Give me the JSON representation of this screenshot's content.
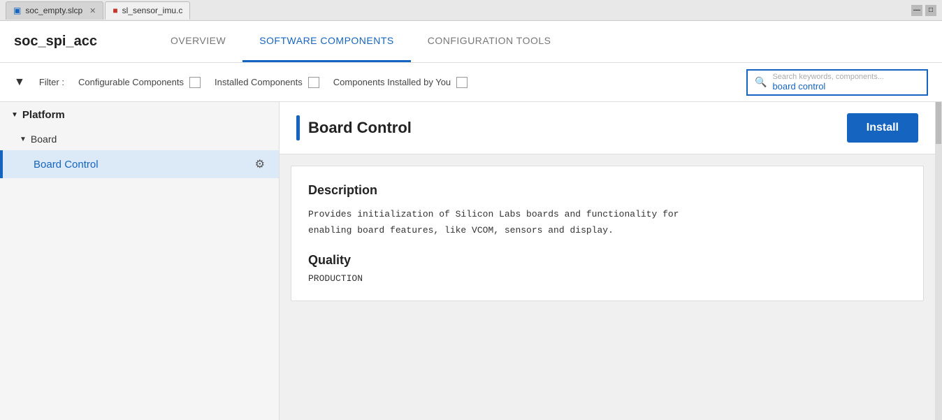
{
  "tabs": {
    "items": [
      {
        "id": "soc-empty",
        "label": "soc_empty.slcp",
        "icon": "slcp",
        "active": false
      },
      {
        "id": "sl-sensor",
        "label": "sl_sensor_imu.c",
        "icon": "c-file",
        "active": true
      }
    ]
  },
  "nav": {
    "app_title": "soc_spi_acc",
    "tabs": [
      {
        "id": "overview",
        "label": "OVERVIEW",
        "active": false
      },
      {
        "id": "software-components",
        "label": "SOFTWARE COMPONENTS",
        "active": true
      },
      {
        "id": "configuration-tools",
        "label": "CONFIGURATION TOOLS",
        "active": false
      }
    ]
  },
  "filter": {
    "label": "Filter :",
    "configurable_label": "Configurable Components",
    "installed_label": "Installed Components",
    "by_you_label": "Components Installed by You",
    "search_placeholder": "Search keywords, components...",
    "search_value": "board control"
  },
  "sidebar": {
    "platform_label": "Platform",
    "board_label": "Board",
    "board_control_label": "Board Control"
  },
  "detail": {
    "title": "Board Control",
    "install_button": "Install",
    "description_title": "Description",
    "description_text": "Provides initialization of Silicon Labs boards and functionality for\nenabling board features, like VCOM, sensors and display.",
    "quality_title": "Quality",
    "quality_value": "PRODUCTION"
  }
}
